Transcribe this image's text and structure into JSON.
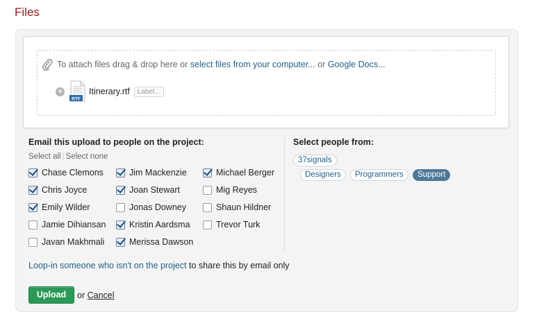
{
  "page_title": "Files",
  "attach": {
    "prefix": "To attach files drag & drop here or",
    "select_link": "select files from your computer...",
    "or": "or",
    "google_link": "Google Docs..."
  },
  "file": {
    "name": "Itinerary.rtf",
    "type_badge": "RTF",
    "label_button": "Label..."
  },
  "email_section": {
    "heading": "Email this upload to people on the project:",
    "select_all": "Select all",
    "separator": "|",
    "select_none": "Select none"
  },
  "people": [
    {
      "name": "Chase Clemons",
      "checked": true
    },
    {
      "name": "Jim Mackenzie",
      "checked": true
    },
    {
      "name": "Michael Berger",
      "checked": true
    },
    {
      "name": "Chris Joyce",
      "checked": true
    },
    {
      "name": "Joan Stewart",
      "checked": true
    },
    {
      "name": "Mig Reyes",
      "checked": false
    },
    {
      "name": "Emily Wilder",
      "checked": true
    },
    {
      "name": "Jonas Downey",
      "checked": false
    },
    {
      "name": "Shaun Hildner",
      "checked": false
    },
    {
      "name": "Jamie Dihiansan",
      "checked": false
    },
    {
      "name": "Kristin Aardsma",
      "checked": true
    },
    {
      "name": "Trevor Turk",
      "checked": false
    },
    {
      "name": "Javan Makhmali",
      "checked": false
    },
    {
      "name": "Merissa Dawson",
      "checked": true
    }
  ],
  "select_from": {
    "heading": "Select people from:",
    "groups": [
      {
        "label": "37signals",
        "active": false
      },
      {
        "label": "Designers",
        "active": false
      },
      {
        "label": "Programmers",
        "active": false
      },
      {
        "label": "Support",
        "active": true
      }
    ]
  },
  "loop_in": {
    "link": "Loop-in someone who isn't on the project",
    "suffix": "to share this by email only"
  },
  "actions": {
    "upload": "Upload",
    "or": "or",
    "cancel": "Cancel"
  },
  "colors": {
    "title": "#a3171b",
    "link": "#1f5f8b",
    "upload_button": "#2a9a56",
    "active_tag": "#4e7898"
  }
}
